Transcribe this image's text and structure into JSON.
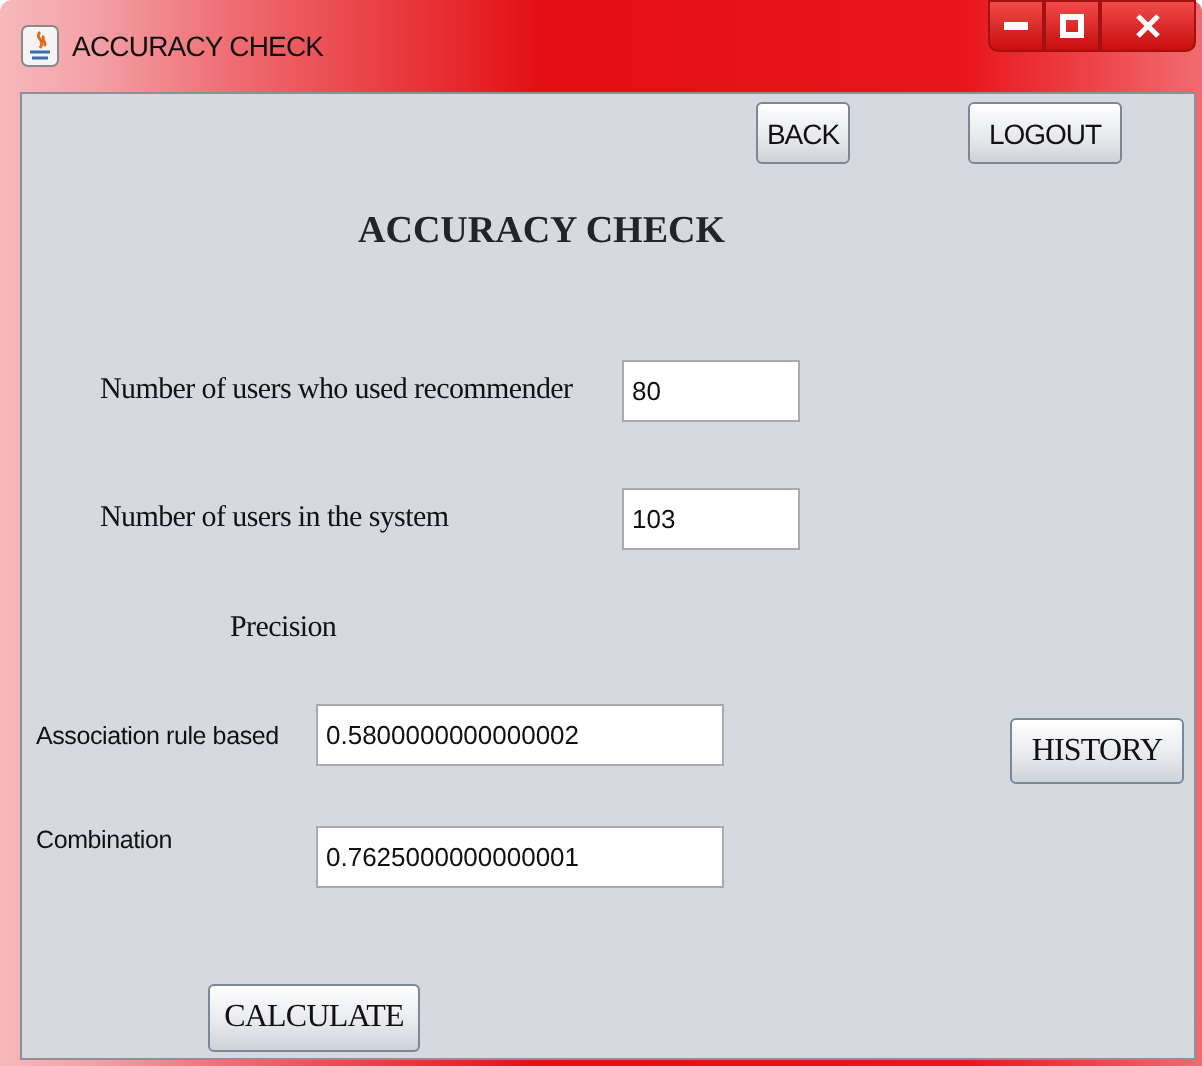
{
  "window": {
    "title": "ACCURACY CHECK"
  },
  "top_buttons": [
    "BACK",
    "LOGOUT"
  ],
  "heading": "ACCURACY CHECK",
  "inputs": [
    {
      "label": "Number of users who used recommender",
      "value": "80"
    },
    {
      "label": "Number of users in the system",
      "value": "103"
    }
  ],
  "section_label": "Precision",
  "results": [
    {
      "label": "Association rule based",
      "value": "0.5800000000000002"
    },
    {
      "label": "Combination",
      "value": "0.7625000000000001"
    }
  ],
  "history_button": "HISTORY",
  "calculate_button": "CALCULATE"
}
